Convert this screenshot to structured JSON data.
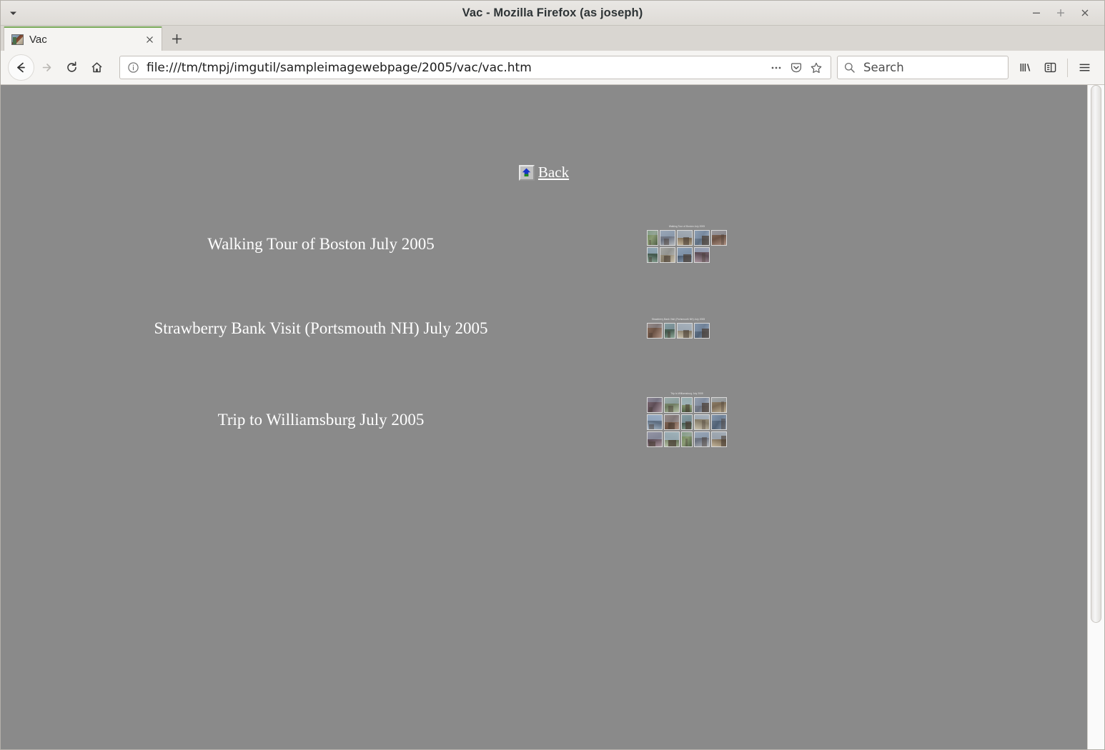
{
  "window": {
    "title": "Vac - Mozilla Firefox (as joseph)",
    "menu_arrow_icon": "chevron-down-icon",
    "minimize_icon": "minimize-icon",
    "maximize_icon": "maximize-icon",
    "close_icon": "close-icon"
  },
  "tabs": {
    "active": {
      "label": "Vac",
      "favicon_icon": "page-photo-favicon",
      "close_icon": "close-icon"
    },
    "new_tab_label": "+"
  },
  "toolbar": {
    "back_icon": "back-arrow-icon",
    "forward_icon": "forward-arrow-icon",
    "reload_icon": "reload-icon",
    "home_icon": "home-icon",
    "url": "file:///tm/tmpj/imgutil/sampleimagewebpage/2005/vac/vac.htm",
    "url_info_icon": "info-circle-icon",
    "page_actions_icon": "ellipsis-icon",
    "pocket_icon": "pocket-icon",
    "bookmark_icon": "star-icon",
    "library_icon": "library-icon",
    "sidebar_icon": "sidebar-icon",
    "menu_icon": "hamburger-menu-icon"
  },
  "search": {
    "placeholder": "Search",
    "value": "",
    "icon": "search-icon"
  },
  "page": {
    "background_color": "#8a8a8a",
    "back_link": {
      "label": "Back",
      "icon": "home-up-arrow-icon"
    },
    "albums": [
      {
        "title": "Walking Tour of Boston July 2005",
        "sheet_caption": "Walking Tour of Boston July 2005",
        "rows": [
          5,
          4
        ]
      },
      {
        "title": "Strawberry Bank Visit (Portsmouth NH) July 2005",
        "sheet_caption": "Strawberry Bank Visit (Portsmouth NH) July 2005",
        "rows": [
          4
        ]
      },
      {
        "title": "Trip to Williamsburg July 2005",
        "sheet_caption": "Trip to Williamsburg July 2005",
        "rows": [
          5,
          5,
          5
        ]
      }
    ]
  },
  "scrollbar": {
    "orientation": "vertical",
    "thumb_position_percent": 0,
    "thumb_size_percent": 81
  }
}
